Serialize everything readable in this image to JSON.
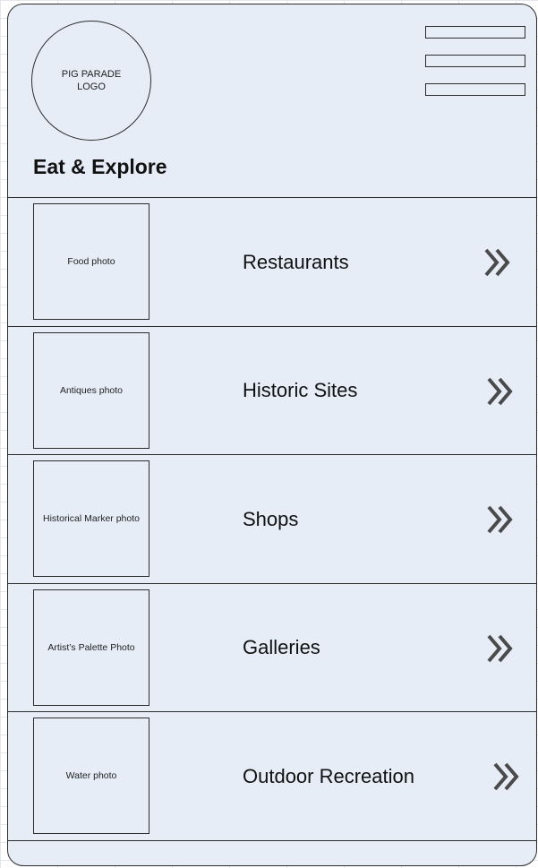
{
  "header": {
    "logo_text": [
      "PIG PARADE",
      "LOGO"
    ],
    "title": "Eat & Explore",
    "menu_icon": "hamburger-menu-icon"
  },
  "categories": [
    {
      "photo_label": "Food photo",
      "label": "Restaurants",
      "icon": "double-chevron-right-icon"
    },
    {
      "photo_label": "Antiques photo",
      "label": "Historic Sites",
      "icon": "double-chevron-right-icon"
    },
    {
      "photo_label": "Historical Marker photo",
      "label": "Shops",
      "icon": "double-chevron-right-icon"
    },
    {
      "photo_label": "Artist’s Palette Photo",
      "label": "Galleries",
      "icon": "double-chevron-right-icon"
    },
    {
      "photo_label": "Water photo",
      "label": "Outdoor Recreation",
      "icon": "double-chevron-right-icon"
    }
  ],
  "colors": {
    "background": "#e6edf7",
    "border": "#2c2c2c",
    "chevron": "#4a4a4a"
  }
}
